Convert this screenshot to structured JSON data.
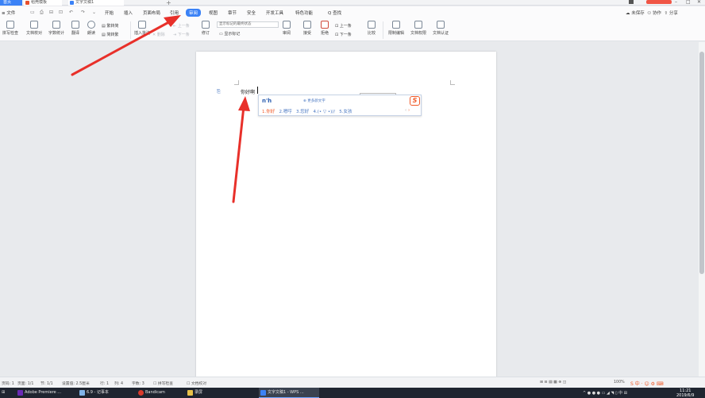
{
  "titlebar": {
    "home_tab": "首页",
    "templates_tab": "稻壳模板",
    "doc_tab": "文字文稿1",
    "add_tab": "+",
    "login_button": "",
    "min": "–",
    "max": "□",
    "close": "✕"
  },
  "menu": {
    "file": "≡ 文件",
    "items": [
      "开始",
      "插入",
      "页面布局",
      "引用",
      "审阅",
      "视图",
      "章节",
      "安全",
      "开发工具",
      "特色功能"
    ],
    "active": "审阅",
    "search": "Q 查找",
    "unsaved": "未保存",
    "collab": "协作",
    "share": "分享"
  },
  "ribbon": {
    "spellcheck": "拼写检查",
    "doc_proof": "文档校对",
    "word_count": "字数统计",
    "translate": "翻译",
    "read_aloud": "朗读",
    "simp_to_trad": "繁转简",
    "trad_to_simp": "简转繁",
    "insert_comment": "插入批注",
    "delete": "删除",
    "prev_item": "上一条",
    "next_item": "下一条",
    "track": "修订",
    "markup_state": "显示标记的最终状态",
    "show_markup": "显示标记",
    "reviewers": "审阅",
    "accept": "接受",
    "reject": "拒绝",
    "prev": "上一条",
    "next": "下一条",
    "compare": "比较",
    "restrict_edit": "限制编辑",
    "doc_rights": "文档权限",
    "doc_cert": "文档认证"
  },
  "document": {
    "typed_text": "你好啊",
    "para_icon": "⎘"
  },
  "ime": {
    "input": "n'h",
    "more": "⊕ 更多颜文字",
    "logo": "S",
    "candidates": [
      "1.你好",
      "2.嗯哼",
      "3.您好",
      "4.(• ▽ •)//",
      "5.女孩"
    ],
    "prev": "‹",
    "next": "›"
  },
  "status": {
    "page_num": "页码: 1",
    "pages": "页面: 1/1",
    "section": "节: 1/1",
    "position": "设置值: 2.5厘米",
    "line": "行: 1",
    "column": "列: 4",
    "char_count": "字数: 3",
    "spell": "拼写检查",
    "proof": "文档校对",
    "zoom": "100%"
  },
  "taskbar": {
    "premiere": "Adobe Premiere ...",
    "notepad": "6.9 - 记事本",
    "bandicam": "Bandicam",
    "recording": "录屏",
    "wps": "文字文稿1 - WPS ...",
    "tray": "^ ● ● ● ▭ ◢ ◥ ▯ 中 ⊞",
    "time": "11:21",
    "date": "2019/6/9"
  },
  "colors": {
    "accent": "#3b82f6",
    "annotation": "#e8302a",
    "ime_orange": "#f05a28"
  }
}
